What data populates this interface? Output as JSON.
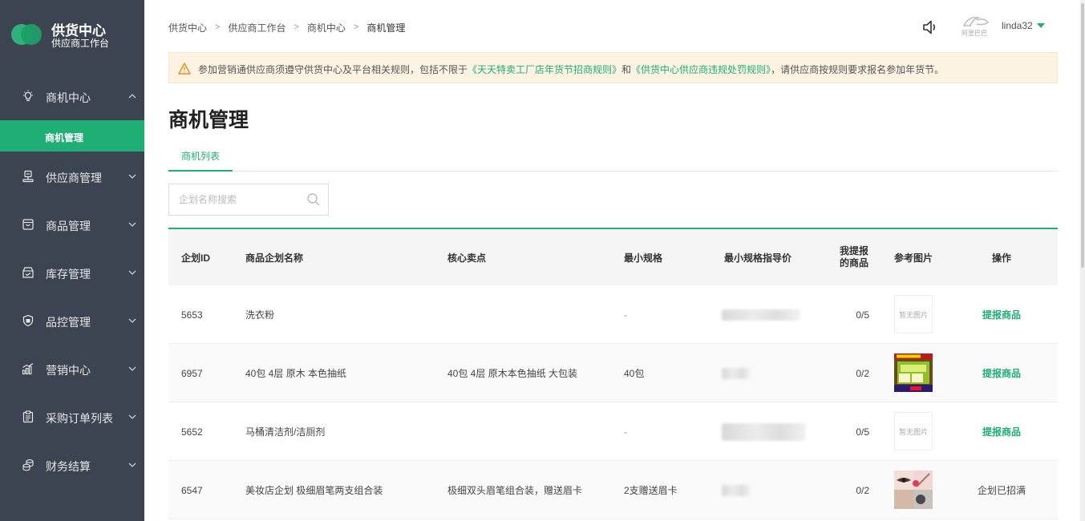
{
  "brand": {
    "title": "供货中心",
    "subtitle": "供应商工作台"
  },
  "sidebar": {
    "items": [
      {
        "label": "商机中心",
        "icon": "lightbulb-icon",
        "expanded": true
      },
      {
        "label": "供应商管理",
        "icon": "supplier-icon"
      },
      {
        "label": "商品管理",
        "icon": "product-box-icon"
      },
      {
        "label": "库存管理",
        "icon": "inventory-icon"
      },
      {
        "label": "品控管理",
        "icon": "shield-icon"
      },
      {
        "label": "营销中心",
        "icon": "bar-chart-icon"
      },
      {
        "label": "采购订单列表",
        "icon": "clipboard-icon"
      },
      {
        "label": "财务结算",
        "icon": "coins-icon"
      }
    ],
    "active_sub": "商机管理",
    "accent": "#1fae74",
    "background": "#3b4450"
  },
  "breadcrumb": [
    "供货中心",
    "供应商工作台",
    "商机中心",
    "商机管理"
  ],
  "header": {
    "username": "linda32",
    "logo_text": "阿里巴巴"
  },
  "notice": {
    "prefix": "参加营销通供应商须遵守供货中心及平台相关规则，包括不限于",
    "link1": "《天天特卖工厂店年货节招商规则》",
    "middle": "和",
    "link2": "《供货中心供应商违规处罚规则》",
    "suffix": "，请供应商按规则要求报名参加年货节。"
  },
  "page_title": "商机管理",
  "tabs": [
    "商机列表"
  ],
  "search": {
    "placeholder": "企划名称搜索",
    "value": ""
  },
  "table": {
    "columns": [
      "企划ID",
      "商品企划名称",
      "核心卖点",
      "最小规格",
      "最小规格指导价",
      "我提报的商品",
      "参考图片",
      "操作"
    ],
    "column_col6_line1": "我提报",
    "column_col6_line2": "的商品",
    "rows": [
      {
        "id": "5653",
        "name": "洗衣粉",
        "selling_point": "",
        "min_spec": "-",
        "submitted": "0/5",
        "image": "暂无图片",
        "action": "提报商品",
        "action_type": "link"
      },
      {
        "id": "6957",
        "name": "40包 4层 原木 本色抽纸",
        "selling_point": "40包 4层 原木本色抽纸 大包装",
        "min_spec": "40包",
        "submitted": "0/2",
        "image": "product-photo",
        "action": "提报商品",
        "action_type": "link"
      },
      {
        "id": "5652",
        "name": "马桶清洁剂/洁厕剂",
        "selling_point": "",
        "min_spec": "-",
        "submitted": "0/5",
        "image": "暂无图片",
        "action": "提报商品",
        "action_type": "link"
      },
      {
        "id": "6547",
        "name": "美妆店企划 极细眉笔两支组合装",
        "selling_point": "极细双头眉笔组合装，赠送眉卡",
        "min_spec": "2支赠送眉卡",
        "submitted": "0/2",
        "image": "product-photo",
        "action": "企划已招满",
        "action_type": "text"
      }
    ]
  }
}
